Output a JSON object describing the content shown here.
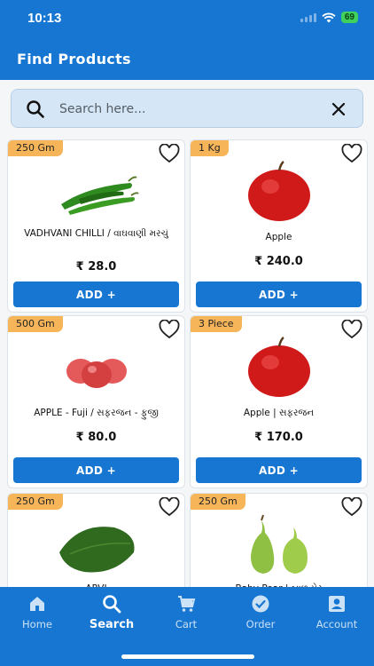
{
  "status_bar": {
    "time": "10:13",
    "battery": "69"
  },
  "header": {
    "title": "Find Products"
  },
  "search": {
    "placeholder": "Search here..."
  },
  "products": [
    {
      "unit": "250 Gm",
      "name": "VADHVANI CHILLI / વાઘવાણી મરચું",
      "price": "₹ 28.0",
      "image": "green-chilli"
    },
    {
      "unit": "1 Kg",
      "name": "Apple",
      "price": "₹ 240.0",
      "image": "red-apple"
    },
    {
      "unit": "500 Gm",
      "name": "APPLE - Fuji / સફરજન - ફુજી",
      "price": "₹ 80.0",
      "image": "fuji-apples"
    },
    {
      "unit": "3 Piece",
      "name": "Apple | સફરજન",
      "price": "₹ 170.0",
      "image": "red-apple"
    },
    {
      "unit": "250 Gm",
      "name": "ARVI",
      "price": "",
      "image": "arvi-leaf"
    },
    {
      "unit": "250 Gm",
      "name": "Baby Pear | બાળ પેર",
      "price": "",
      "image": "green-pears"
    }
  ],
  "add_label": "ADD +",
  "nav": [
    {
      "label": "Home",
      "icon": "home-icon",
      "active": false
    },
    {
      "label": "Search",
      "icon": "search-icon",
      "active": true
    },
    {
      "label": "Cart",
      "icon": "cart-icon",
      "active": false
    },
    {
      "label": "Order",
      "icon": "order-icon",
      "active": false
    },
    {
      "label": "Account",
      "icon": "account-icon",
      "active": false
    }
  ],
  "colors": {
    "primary": "#1676d2",
    "badge": "#f7b55a",
    "search_bg": "#d5e7f7"
  }
}
